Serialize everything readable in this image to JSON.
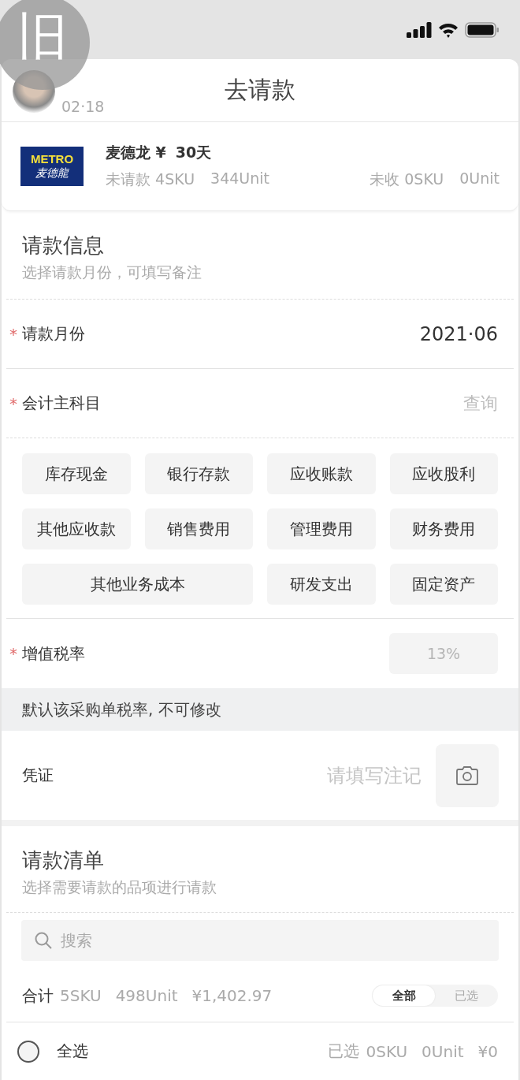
{
  "badge": "旧",
  "header": {
    "date": "02·18",
    "title": "去请款"
  },
  "merchant": {
    "logo_top": "METRO",
    "logo_bottom": "麦德龍",
    "name": "麦德龙 ¥",
    "term": "30天",
    "left_stats": [
      "未请款 4SKU",
      "344Unit"
    ],
    "right_stats": [
      "未收 0SKU",
      "0Unit"
    ]
  },
  "info": {
    "title": "请款信息",
    "subtitle": "选择请款月份，可填写备注",
    "fields": [
      {
        "kind": "value",
        "label": "请款月份",
        "mark": "*",
        "value": "2021·06"
      },
      {
        "kind": "picker",
        "label": "会计主科目",
        "mark": "*",
        "placeholder": "查询"
      }
    ],
    "subjects": [
      {
        "label": "库存现金",
        "wide": false
      },
      {
        "label": "银行存款",
        "wide": false
      },
      {
        "label": "应收账款",
        "wide": false
      },
      {
        "label": "应收股利",
        "wide": false
      },
      {
        "label": "其他应收款",
        "wide": false
      },
      {
        "label": "销售费用",
        "wide": false
      },
      {
        "label": "管理费用",
        "wide": false
      },
      {
        "label": "财务费用",
        "wide": false
      },
      {
        "label": "其他业务成本",
        "wide": true
      },
      {
        "label": "研发支出",
        "wide": false
      },
      {
        "label": "固定资产",
        "wide": false
      }
    ],
    "tax": {
      "label": "增值税率",
      "mark": "*",
      "value": "13%",
      "disabled": true
    },
    "note": "默认该采购单税率, 不可修改",
    "voucher": {
      "label": "凭证",
      "placeholder": "请填写注记"
    }
  },
  "list": {
    "title": "请款清单",
    "subtitle": "选择需要请款的品项进行请款",
    "search_placeholder": "搜索",
    "summary": {
      "label": "合计",
      "stats": [
        "5SKU",
        "498Unit",
        "¥1,402.97"
      ]
    },
    "filters": [
      {
        "label": "全部",
        "selected": true
      },
      {
        "label": "已选",
        "selected": false
      }
    ],
    "footer": {
      "select_all": {
        "label": "全选",
        "checked": false
      },
      "label": "已选",
      "stats": [
        "0SKU",
        "0Unit",
        "¥0"
      ]
    }
  }
}
